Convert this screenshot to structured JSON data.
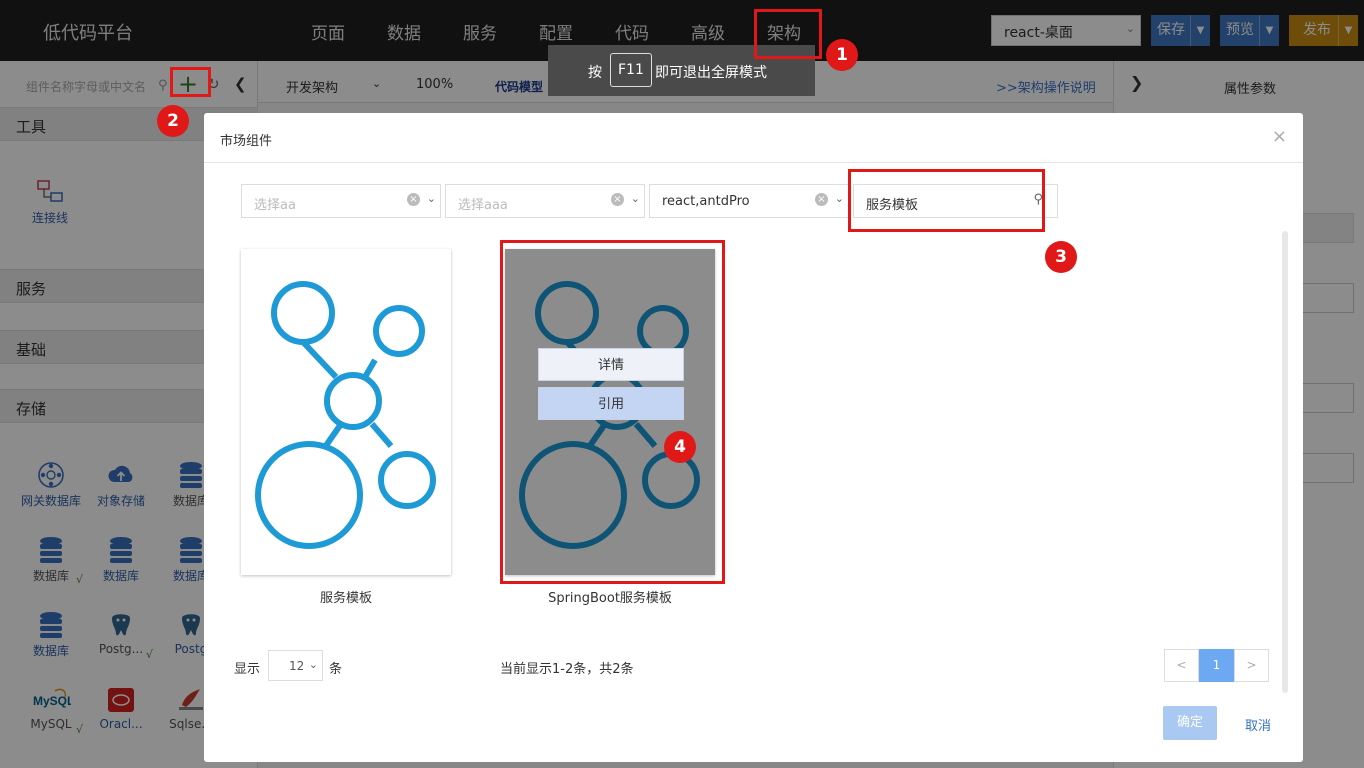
{
  "app": {
    "brand": "低代码平台"
  },
  "nav": {
    "items": [
      {
        "label": "页面"
      },
      {
        "label": "数据"
      },
      {
        "label": "服务"
      },
      {
        "label": "配置"
      },
      {
        "label": "代码"
      },
      {
        "label": "高级"
      },
      {
        "label": "架构"
      }
    ],
    "active": "架构"
  },
  "header": {
    "project": "react-桌面",
    "save": "保存",
    "preview": "预览",
    "publish": "发布"
  },
  "fullscreen_tip": {
    "before": "按",
    "key": "F11",
    "after": "即可退出全屏模式"
  },
  "left_panel": {
    "search_placeholder": "组件名称字母或中文名",
    "sections": [
      "工具",
      "服务",
      "基础",
      "存储"
    ],
    "tools": [
      {
        "label": "连接线"
      }
    ],
    "storage": [
      {
        "label": "网关数据库"
      },
      {
        "label": "对象存储"
      },
      {
        "label": "数据库"
      },
      {
        "label": "数据库"
      },
      {
        "label": "数据库"
      },
      {
        "label": "数据库"
      },
      {
        "label": "数据库"
      },
      {
        "label": "Postg..."
      },
      {
        "label": "Postg"
      },
      {
        "label": "MySQL"
      },
      {
        "label": "Oracl..."
      },
      {
        "label": "Sqlse..."
      }
    ],
    "check": "√"
  },
  "center_toolbar": {
    "arch": "开发架构",
    "zoom": "100%",
    "code_model": "代码模型",
    "help": ">>架构操作说明"
  },
  "right_panel": {
    "title": "属性参数"
  },
  "modal": {
    "title": "市场组件",
    "filters": [
      {
        "placeholder": "选择aa",
        "value": ""
      },
      {
        "placeholder": "选择aaa",
        "value": ""
      },
      {
        "placeholder": "",
        "value": "react,antdPro"
      }
    ],
    "search_value": "服务模板",
    "cards": [
      {
        "name": "服务模板"
      },
      {
        "name": "SpringBoot服务模板"
      }
    ],
    "card_actions": {
      "detail": "详情",
      "use": "引用"
    },
    "footer": {
      "show": "显示",
      "page_size": "12",
      "unit": "条",
      "info": "当前显示1-2条，共2条",
      "prev": "<",
      "page": "1",
      "next": ">",
      "ok": "确定",
      "cancel": "取消"
    }
  },
  "annotations": [
    "1",
    "2",
    "3",
    "4"
  ],
  "colors": {
    "topbar": "#1f1f1f",
    "primary": "#3f78c5",
    "publish": "#c88a12",
    "annotation": "#e01818",
    "network_icon": "#1e9ad6"
  }
}
